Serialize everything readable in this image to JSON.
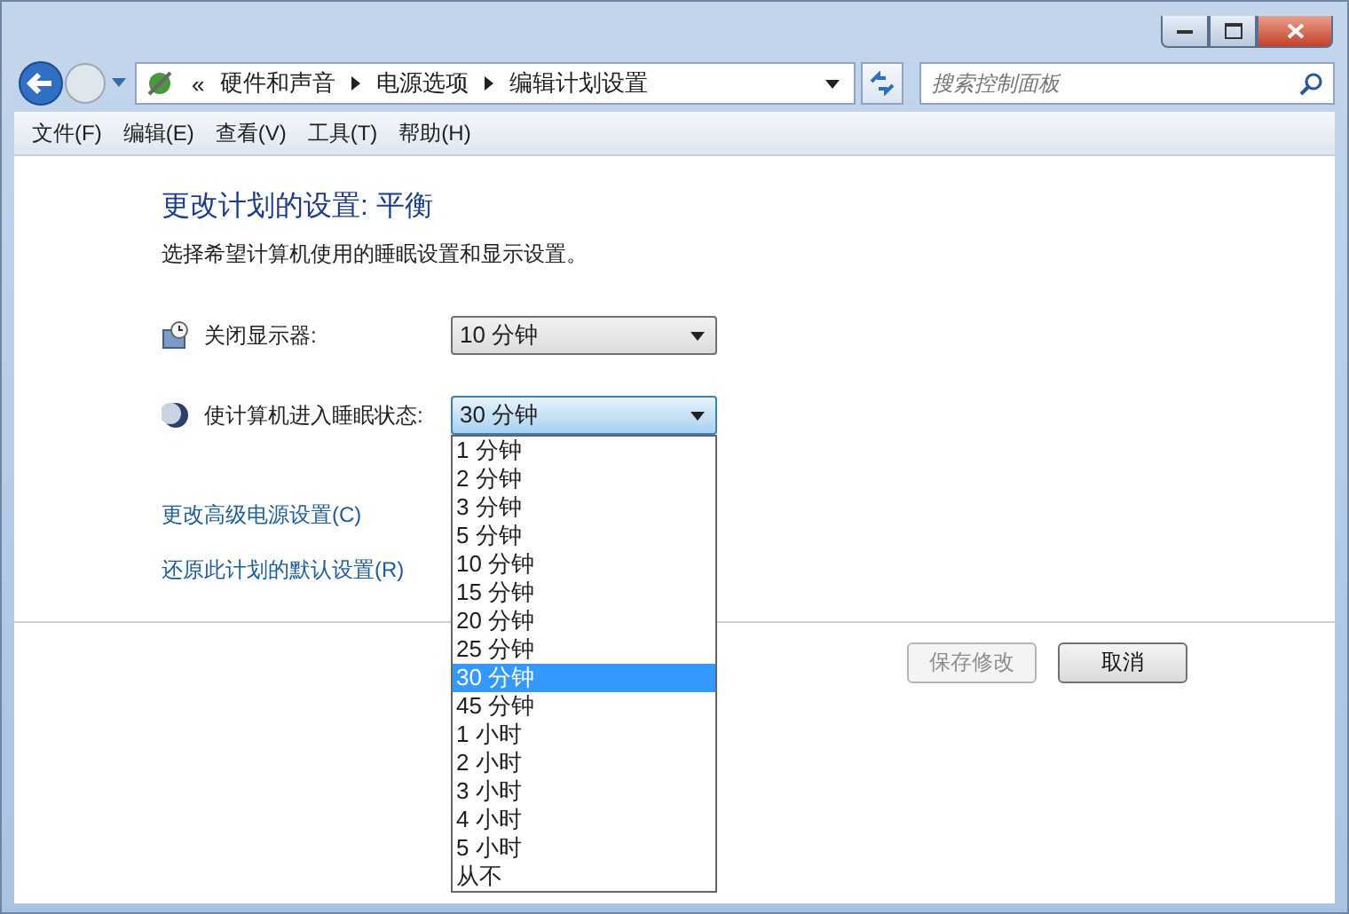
{
  "nav": {
    "overflow": "«",
    "breadcrumb": [
      "硬件和声音",
      "电源选项",
      "编辑计划设置"
    ],
    "search": {
      "placeholder": "搜索控制面板"
    }
  },
  "menu": [
    "文件(F)",
    "编辑(E)",
    "查看(V)",
    "工具(T)",
    "帮助(H)"
  ],
  "heading": "更改计划的设置: 平衡",
  "description": "选择希望计算机使用的睡眠设置和显示设置。",
  "settings": [
    {
      "kind": "display",
      "label": "关闭显示器:",
      "value": "10 分钟",
      "open": false
    },
    {
      "kind": "sleep",
      "label": "使计算机进入睡眠状态:",
      "value": "30 分钟",
      "open": true
    }
  ],
  "options": [
    {
      "label": "1 分钟",
      "selected": false
    },
    {
      "label": "2 分钟",
      "selected": false
    },
    {
      "label": "3 分钟",
      "selected": false
    },
    {
      "label": "5 分钟",
      "selected": false
    },
    {
      "label": "10 分钟",
      "selected": false
    },
    {
      "label": "15 分钟",
      "selected": false
    },
    {
      "label": "20 分钟",
      "selected": false
    },
    {
      "label": "25 分钟",
      "selected": false
    },
    {
      "label": "30 分钟",
      "selected": true
    },
    {
      "label": "45 分钟",
      "selected": false
    },
    {
      "label": "1 小时",
      "selected": false
    },
    {
      "label": "2 小时",
      "selected": false
    },
    {
      "label": "3 小时",
      "selected": false
    },
    {
      "label": "4 小时",
      "selected": false
    },
    {
      "label": "5 小时",
      "selected": false
    },
    {
      "label": "从不",
      "selected": false
    }
  ],
  "links": [
    "更改高级电源设置(C)",
    "还原此计划的默认设置(R)"
  ],
  "buttons": [
    {
      "label": "保存修改",
      "disabled": true
    },
    {
      "label": "取消",
      "disabled": false
    }
  ]
}
